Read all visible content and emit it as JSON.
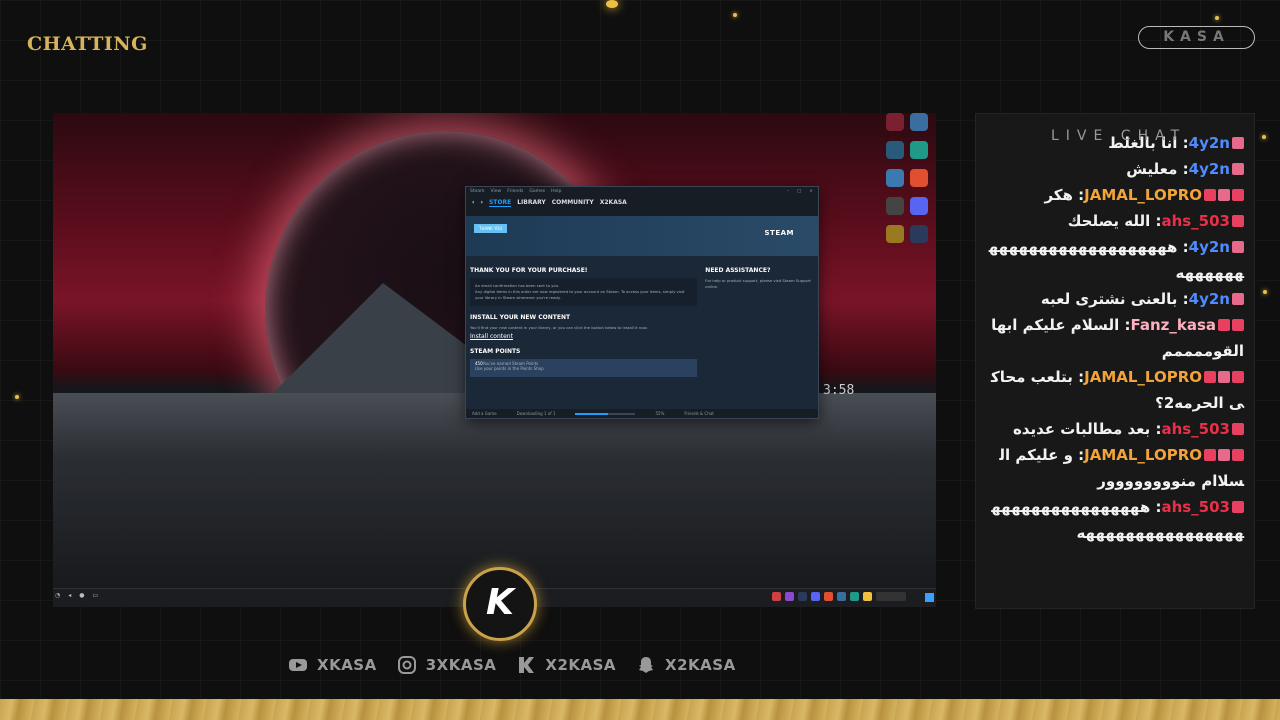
{
  "overlay": {
    "title": "CHATTING",
    "brand": "KASA",
    "logo_letter": "K",
    "accent_color": "#d8b35a"
  },
  "stream": {
    "clock": "3:58",
    "steam": {
      "menu": [
        "Steam",
        "View",
        "Friends",
        "Games",
        "Help"
      ],
      "nav": [
        "STORE",
        "LIBRARY",
        "COMMUNITY",
        "X2KASA"
      ],
      "active_nav": "STORE",
      "banner_tag": "THANK YOU",
      "logo": "STEAM",
      "purchase_heading": "THANK YOU FOR YOUR PURCHASE!",
      "confirmation": "An email confirmation has been sent to you.",
      "digital_items": "Any digital items in this order are now registered to your account on Steam. To access your items, simply visit your library in Steam whenever you're ready.",
      "install_heading": "INSTALL YOUR NEW CONTENT",
      "install_text": "You'll find your new content in your library, or you can click the button below to install it now.",
      "install_link": "Install content",
      "points_heading": "STEAM POINTS",
      "points_text": "You've earned Steam Points",
      "points_sub": "Use your points in the Points Shop",
      "points_value": "450",
      "assist_heading": "NEED ASSISTANCE?",
      "assist_text": "For help or product support, please visit Steam Support online.",
      "add_game": "Add a Game",
      "downloading": "Downloading 1 of 1",
      "download_pct": "55%",
      "friends": "Friends & Chat"
    }
  },
  "chat": {
    "title": "LIVE CHAT",
    "messages": [
      {
        "user": "4y2n",
        "color": "blue",
        "badges": [
          "heart"
        ],
        "text": "انا بالغلط"
      },
      {
        "user": "4y2n",
        "color": "blue",
        "badges": [
          "heart"
        ],
        "text": "معليش"
      },
      {
        "user": "JAMAL_LOPRO",
        "color": "orange",
        "badges": [
          "pen",
          "heart",
          "og"
        ],
        "text": "هكر"
      },
      {
        "user": "ahs_503",
        "color": "red",
        "badges": [
          "pen"
        ],
        "text": "الله يصلحك"
      },
      {
        "user": "4y2n",
        "color": "blue",
        "badges": [
          "heart"
        ],
        "text": "هههههههههههههههههههههههههه"
      },
      {
        "user": "4y2n",
        "color": "blue",
        "badges": [
          "heart"
        ],
        "text": "بالعنى نشترى لعبه"
      },
      {
        "user": "Fanz_kasa",
        "color": "pink",
        "badges": [
          "pen",
          "og"
        ],
        "text": "السلام عليكم ابها القوممممم"
      },
      {
        "user": "JAMAL_LOPRO",
        "color": "orange",
        "badges": [
          "pen",
          "heart",
          "og"
        ],
        "text": "بتلعب محاكى الحرمه2؟"
      },
      {
        "user": "ahs_503",
        "color": "red",
        "badges": [
          "pen"
        ],
        "text": "بعد مطالبات عديده"
      },
      {
        "user": "JAMAL_LOPRO",
        "color": "orange",
        "badges": [
          "pen",
          "heart",
          "og"
        ],
        "text": "و عليكم السلاام منوووووووور"
      },
      {
        "user": "ahs_503",
        "color": "red",
        "badges": [
          "pen"
        ],
        "text": "ههههههههههههههههههههههههههههههههه"
      }
    ]
  },
  "socials": [
    {
      "icon": "youtube-icon",
      "label": "XKASA"
    },
    {
      "icon": "instagram-icon",
      "label": "3XKASA"
    },
    {
      "icon": "kick-icon",
      "label": "X2KASA"
    },
    {
      "icon": "snapchat-icon",
      "label": "X2KASA"
    }
  ]
}
